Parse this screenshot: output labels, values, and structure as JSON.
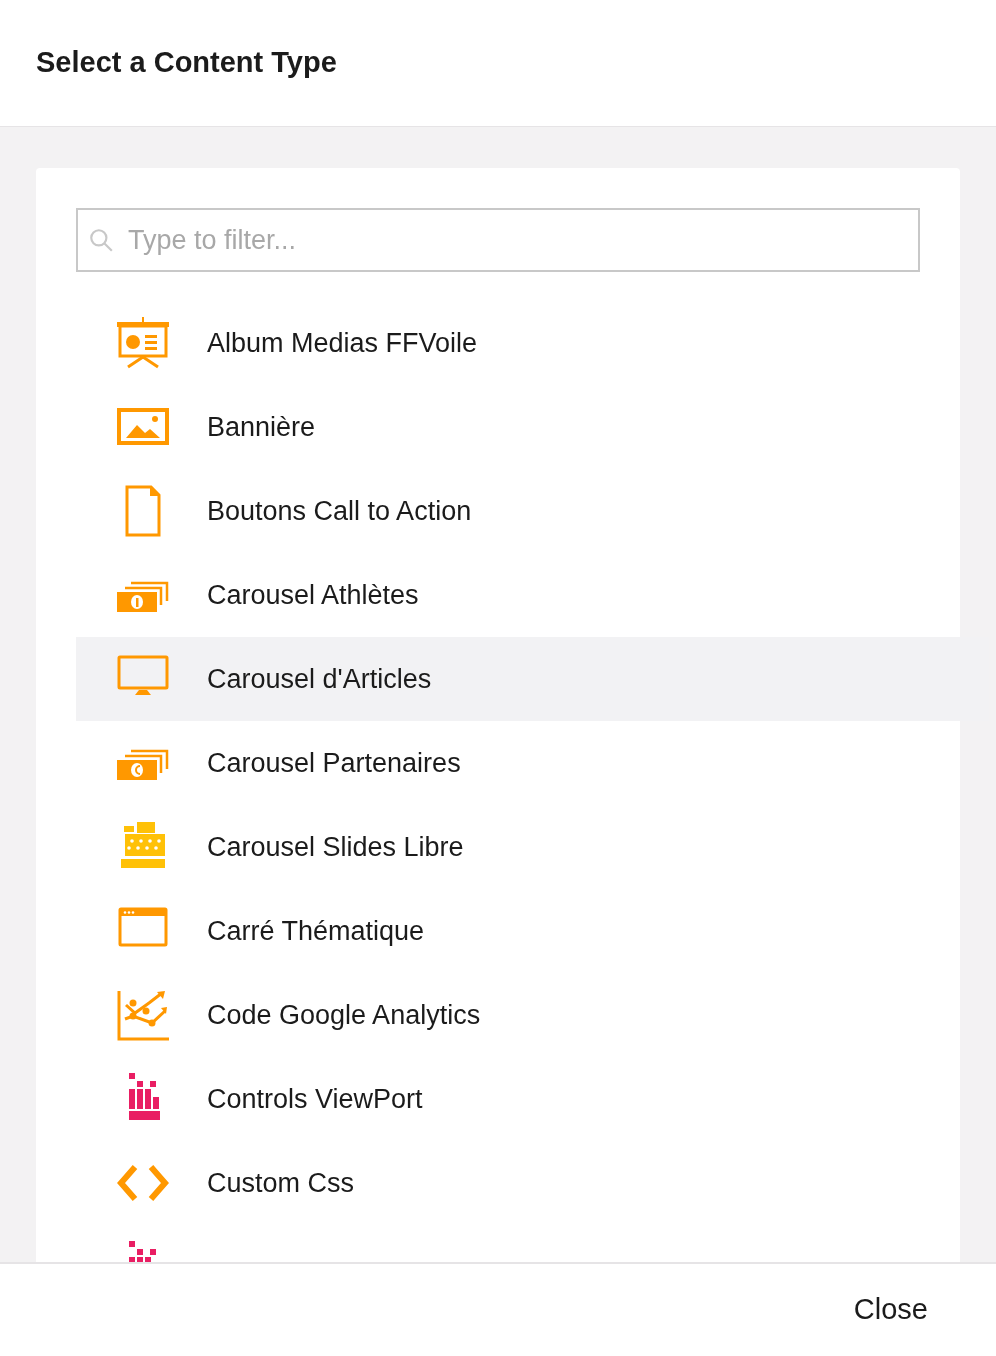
{
  "dialog": {
    "title": "Select a Content Type"
  },
  "search": {
    "placeholder": "Type to filter..."
  },
  "items": [
    {
      "kind": "presentation",
      "label": "Album Medias FFVoile",
      "selected": false
    },
    {
      "kind": "image",
      "label": "Bannière",
      "selected": false
    },
    {
      "kind": "document",
      "label": "Boutons Call to Action",
      "selected": false
    },
    {
      "kind": "bills-number",
      "label": "Carousel Athlètes",
      "selected": false
    },
    {
      "kind": "monitor",
      "label": "Carousel d'Articles",
      "selected": true
    },
    {
      "kind": "bills-euro",
      "label": "Carousel Partenaires",
      "selected": false
    },
    {
      "kind": "register",
      "label": "Carousel Slides Libre",
      "selected": false
    },
    {
      "kind": "window",
      "label": "Carré Thématique",
      "selected": false
    },
    {
      "kind": "chart",
      "label": "Code Google Analytics",
      "selected": false
    },
    {
      "kind": "blocks",
      "label": "Controls ViewPort",
      "selected": false
    },
    {
      "kind": "code",
      "label": "Custom Css",
      "selected": false
    },
    {
      "kind": "blocks",
      "selected": false
    }
  ],
  "footer": {
    "close_label": "Close"
  }
}
